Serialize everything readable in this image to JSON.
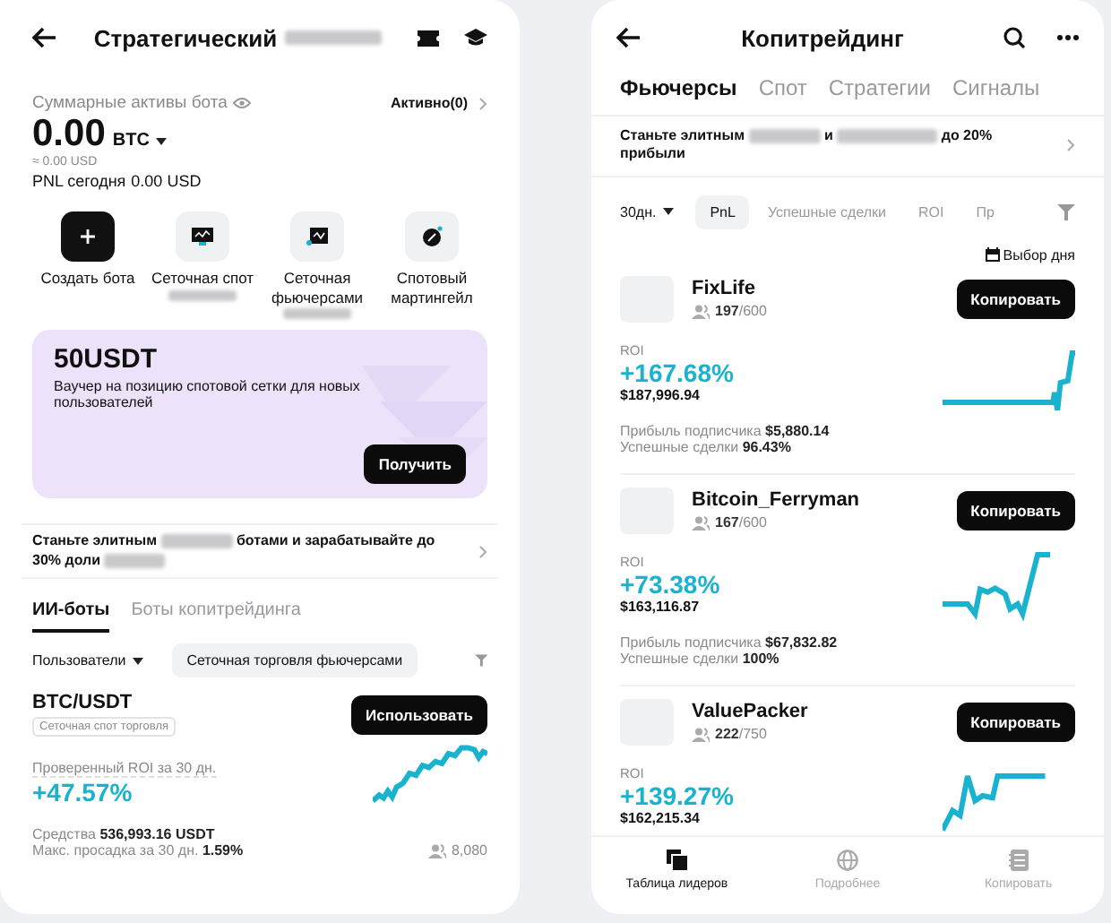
{
  "bots_screen": {
    "header": {
      "title": "Стратегический",
      "redacted": true
    },
    "assets": {
      "label": "Суммарные активы бота",
      "active_link": "Активно(0)",
      "amount": "0.00",
      "currency": "BTC",
      "usd": "≈ 0.00 USD",
      "pnl_label": "PNL сегодня",
      "pnl_value": "0.00 USD"
    },
    "actions": [
      {
        "label": "Создать бота",
        "kind": "create",
        "redacted": false
      },
      {
        "label": "Сеточная спот",
        "kind": "grid-spot",
        "redacted": true
      },
      {
        "label": "Сеточная фьючерсами",
        "kind": "grid-futures",
        "redacted": true
      },
      {
        "label": "Спотовый мартингейл",
        "kind": "martingale",
        "redacted": false
      }
    ],
    "promo": {
      "title": "50USDT",
      "text": "Ваучер на позицию спотовой сетки для новых пользователей",
      "button": "Получить"
    },
    "banner": {
      "parts": [
        "Станьте элитным",
        "ботами и зарабатывайте до 30% доли"
      ]
    },
    "tabs": [
      {
        "label": "ИИ-боты",
        "selected": true
      },
      {
        "label": "Боты копитрейдинга",
        "selected": false
      }
    ],
    "filters": {
      "dropdown": "Пользователи",
      "chip": "Сеточная торговля фьючерсами"
    },
    "bots": [
      {
        "pair": "BTC/USDT",
        "tag": "Сеточная спот торговля",
        "button": "Использовать",
        "roi_label": "Проверенный ROI за 30 дн.",
        "roi": "+47.57%",
        "funds_label": "Средства",
        "funds": "536,993.16 USDT",
        "drawdown_label": "Макс. просадка за 30 дн.",
        "drawdown": "1.59%",
        "users": "8,080"
      }
    ]
  },
  "copy_screen": {
    "header": {
      "title": "Копитрейдинг"
    },
    "tabs": [
      {
        "label": "Фьючерсы",
        "selected": true
      },
      {
        "label": "Спот",
        "selected": false
      },
      {
        "label": "Стратегии",
        "selected": false
      },
      {
        "label": "Сигналы",
        "selected": false
      }
    ],
    "banner": {
      "parts": [
        "Станьте элитным",
        "и",
        "до 20% прибыли"
      ]
    },
    "period": "30дн.",
    "sort_chips": [
      {
        "label": "PnL",
        "selected": true
      },
      {
        "label": "Успешные сделки",
        "selected": false
      },
      {
        "label": "ROI",
        "selected": false
      },
      {
        "label": "Пр",
        "selected": false
      }
    ],
    "date_pick": "Выбор дня",
    "traders": [
      {
        "name": "FixLife",
        "followers": "197",
        "capacity": "/600",
        "button": "Копировать",
        "roi_label": "ROI",
        "roi": "+167.68%",
        "amount": "$187,996.94",
        "profit_label": "Прибыль подписчика",
        "profit": "$5,880.14",
        "win_label": "Успешные сделки",
        "win": "96.43%"
      },
      {
        "name": "Bitcoin_Ferryman",
        "followers": "167",
        "capacity": "/600",
        "button": "Копировать",
        "roi_label": "ROI",
        "roi": "+73.38%",
        "amount": "$163,116.87",
        "profit_label": "Прибыль подписчика",
        "profit": "$67,832.82",
        "win_label": "Успешные сделки",
        "win": "100%"
      },
      {
        "name": "ValuePacker",
        "followers": "222",
        "capacity": "/750",
        "button": "Копировать",
        "roi_label": "ROI",
        "roi": "+139.27%",
        "amount": "$162,215.34"
      }
    ],
    "nav": [
      {
        "label": "Таблица лидеров",
        "kind": "leaders",
        "selected": true
      },
      {
        "label": "Подробнее",
        "kind": "more",
        "selected": false
      },
      {
        "label": "Копировать",
        "kind": "copy",
        "selected": false
      }
    ]
  }
}
